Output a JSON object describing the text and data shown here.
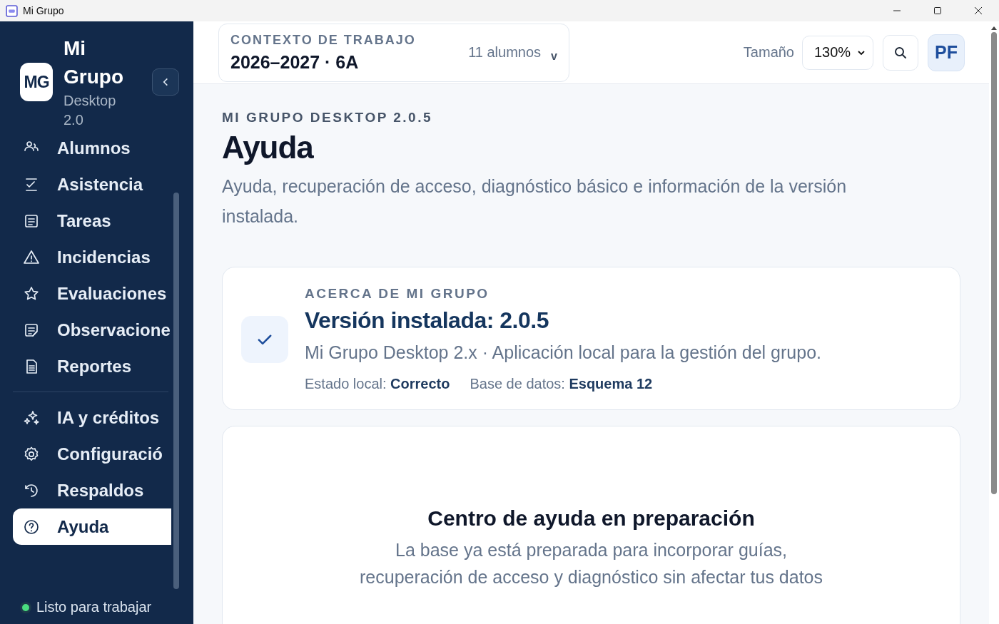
{
  "window": {
    "title": "Mi Grupo"
  },
  "sidebar": {
    "brand": {
      "logo": "MG",
      "title": "Mi Grupo",
      "subtitle": "Desktop 2.0"
    },
    "sections": [
      {
        "items": [
          {
            "label": "Alumnos",
            "kind": "people",
            "selected": false
          },
          {
            "label": "Asistencia",
            "kind": "checklist",
            "selected": false
          },
          {
            "label": "Tareas",
            "kind": "note",
            "selected": false
          },
          {
            "label": "Incidencias",
            "kind": "warning",
            "selected": false
          },
          {
            "label": "Evaluaciones",
            "kind": "star",
            "selected": false
          },
          {
            "label": "Observacione",
            "kind": "memo",
            "selected": false
          },
          {
            "label": "Reportes",
            "kind": "document",
            "selected": false
          }
        ]
      },
      {
        "items": [
          {
            "label": "IA y créditos",
            "kind": "sparkles",
            "selected": false
          },
          {
            "label": "Configuració",
            "kind": "gear",
            "selected": false
          },
          {
            "label": "Respaldos",
            "kind": "history",
            "selected": false
          },
          {
            "label": "Ayuda",
            "kind": "help",
            "selected": true
          }
        ]
      }
    ],
    "status": {
      "text": "Listo para trabajar",
      "ready": true
    }
  },
  "header": {
    "context": {
      "label": "CONTEXTO DE TRABAJO",
      "value": "2026–2027 · 6A",
      "count": "11 alumnos",
      "caret": "v"
    },
    "size": {
      "label": "Tamaño",
      "value": "130%"
    },
    "avatar": "PF"
  },
  "page": {
    "eyebrow": "MI GRUPO DESKTOP 2.0.5",
    "title": "Ayuda",
    "description": "Ayuda, recuperación de acceso, diagnóstico básico e información de la versión instalada."
  },
  "about": {
    "eyebrow": "ACERCA DE MI GRUPO",
    "title": "Versión instalada: 2.0.5",
    "description": "Mi Grupo Desktop 2.x · Aplicación local para la gestión del grupo.",
    "facts": [
      "Estado local: **Correcto**",
      "Base de datos: **Esquema 12**"
    ]
  },
  "help_center": {
    "title": "Centro de ayuda en preparación",
    "description": "La base ya está preparada para incorporar guías, recuperación de acceso y diagnóstico sin afectar tus datos"
  }
}
